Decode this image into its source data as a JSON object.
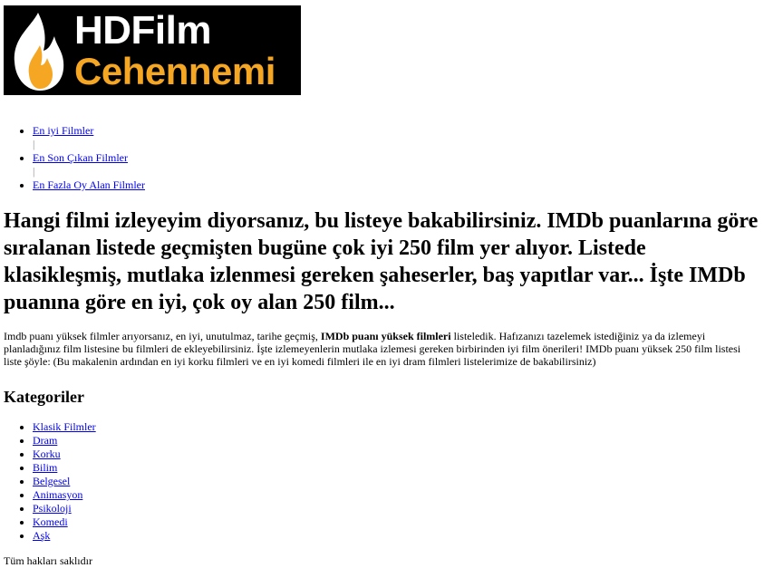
{
  "header": {
    "logo": {
      "line1": "HDFilm",
      "line2": "Cehennemi",
      "accent_color": "#f5a623",
      "icon": "flame-icon"
    }
  },
  "nav": {
    "items": [
      {
        "label": "En iyi Filmler"
      },
      {
        "label": "En Son Çıkan Filmler"
      },
      {
        "label": "En Fazla Oy Alan Filmler"
      }
    ],
    "separator": "|"
  },
  "main": {
    "headline": "Hangi filmi izleyeyim diyorsanız, bu listeye bakabilirsiniz. IMDb puanlarına göre sıralanan listede geçmişten bugüne çok iyi 250 film yer alıyor. Listede klasikleşmiş, mutlaka izlenmesi gereken şaheserler, baş yapıtlar var... İşte IMDb puanına göre en iyi, çok oy alan 250 film...",
    "intro_before": "Imdb puanı yüksek filmler arıyorsanız, en iyi, unutulmaz, tarihe geçmiş, ",
    "intro_bold": "IMDb puanı yüksek filmleri",
    "intro_after": " listeledik. Hafızanızı tazelemek istediğiniz ya da izlemeyi planladığınız film listesine bu filmleri de ekleyebilirsiniz. İşte izlemeyenlerin mutlaka izlemesi gereken birbirinden iyi film önerileri! IMDb puanı yüksek 250 film listesi liste şöyle: (Bu makalenin ardından en iyi korku filmleri ve en iyi komedi filmleri ile en iyi dram filmleri listelerimize de bakabilirsiniz)"
  },
  "categories": {
    "title": "Kategoriler",
    "items": [
      {
        "label": "Klasik Filmler"
      },
      {
        "label": "Dram"
      },
      {
        "label": "Korku"
      },
      {
        "label": "Bilim"
      },
      {
        "label": "Belgesel"
      },
      {
        "label": "Animasyon"
      },
      {
        "label": "Psikoloji"
      },
      {
        "label": "Komedi"
      },
      {
        "label": "Aşk"
      }
    ]
  },
  "footer": {
    "text": "Tüm hakları saklıdır"
  }
}
